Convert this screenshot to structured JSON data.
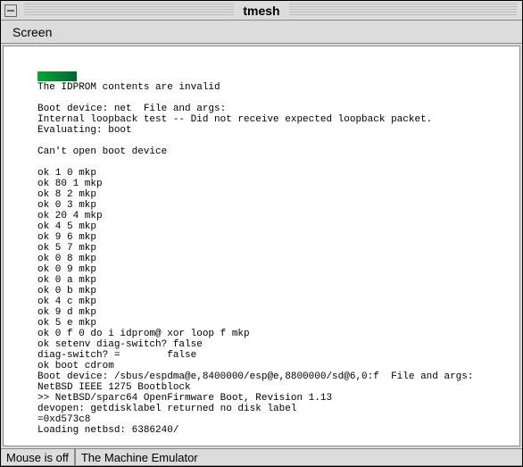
{
  "window": {
    "title": "tmesh"
  },
  "menubar": {
    "items": [
      {
        "label": "Screen"
      }
    ]
  },
  "terminal": {
    "lines": [
      "The IDPROM contents are invalid",
      "",
      "Boot device: net  File and args:",
      "Internal loopback test -- Did not receive expected loopback packet.",
      "Evaluating: boot",
      "",
      "Can't open boot device",
      "",
      "ok 1 0 mkp",
      "ok 80 1 mkp",
      "ok 8 2 mkp",
      "ok 0 3 mkp",
      "ok 20 4 mkp",
      "ok 4 5 mkp",
      "ok 9 6 mkp",
      "ok 5 7 mkp",
      "ok 0 8 mkp",
      "ok 0 9 mkp",
      "ok 0 a mkp",
      "ok 0 b mkp",
      "ok 4 c mkp",
      "ok 9 d mkp",
      "ok 5 e mkp",
      "ok 0 f 0 do i idprom@ xor loop f mkp",
      "ok setenv diag-switch? false",
      "diag-switch? =        false",
      "ok boot cdrom",
      "Boot device: /sbus/espdma@e,8400000/esp@e,8800000/sd@6,0:f  File and args:",
      "NetBSD IEEE 1275 Bootblock",
      ">> NetBSD/sparc64 OpenFirmware Boot, Revision 1.13",
      "devopen: getdisklabel returned no disk label",
      "=0xd573c8",
      "Loading netbsd: 6386240/"
    ]
  },
  "statusbar": {
    "mouse": "Mouse is off",
    "app": "The Machine Emulator"
  }
}
